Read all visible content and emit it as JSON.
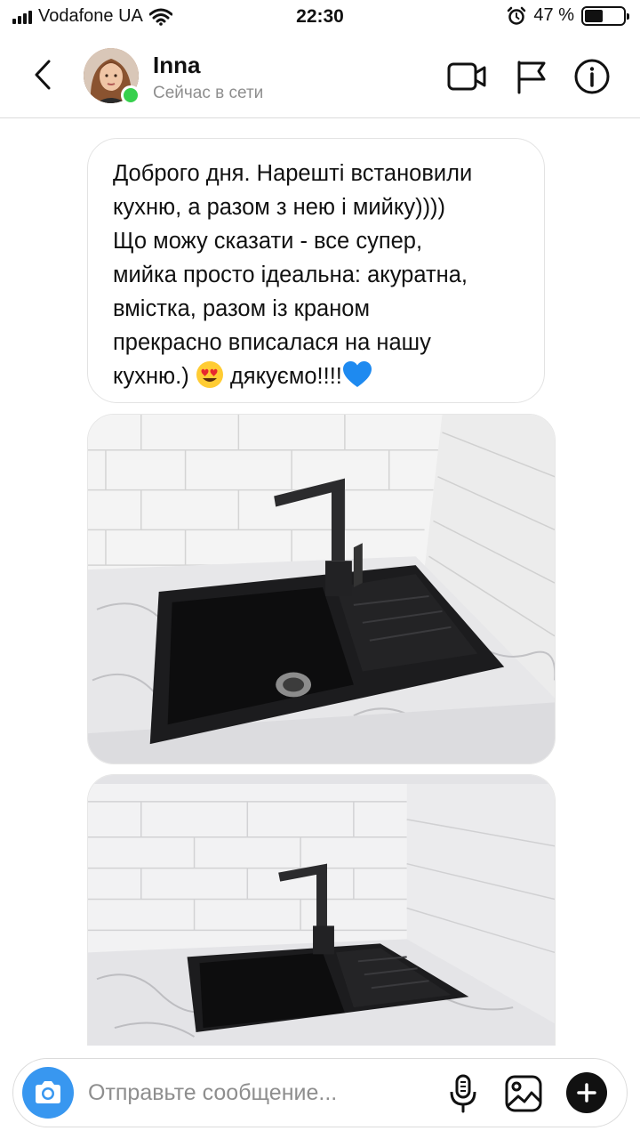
{
  "status_bar": {
    "carrier": "Vodafone UA",
    "time": "22:30",
    "battery_text": "47 %",
    "battery_level": 0.47
  },
  "header": {
    "contact_name": "Inna",
    "contact_status": "Сейчас в сети",
    "icons": [
      "back-icon",
      "video-camera-icon",
      "flag-icon",
      "info-icon"
    ]
  },
  "message": {
    "lines": [
      "Доброго дня. Нарешті встановили",
      "кухню, а разом з нею і мийку))))",
      "Що можу сказати - все супер,",
      "мийка просто ідеальна: акуратна,",
      "вмістка, разом із краном",
      "прекрасно вписалася на нашу",
      "кухню.)",
      "дякуємо!!!!"
    ]
  },
  "composer": {
    "placeholder": "Отправьте сообщение...",
    "icons": [
      "camera-icon",
      "microphone-icon",
      "gallery-icon",
      "plus-icon"
    ]
  },
  "colors": {
    "accent": "#3897f0",
    "online": "#37d04d",
    "border": "#dbdbdb",
    "muted_text": "#8e8e8e"
  }
}
